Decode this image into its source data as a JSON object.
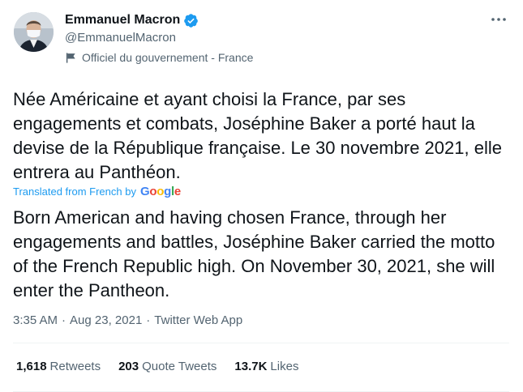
{
  "author": {
    "display_name": "Emmanuel Macron",
    "handle": "@EmmanuelMacron",
    "label": "Officiel du gouvernement - France"
  },
  "tweet": {
    "original_text": "Née Américaine et ayant choisi la France, par ses engagements et combats, Joséphine Baker a porté haut la devise de la République française. Le 30 novembre 2021, elle entrera au Panthéon.",
    "translated_from": "Translated from French by",
    "translator_brand": [
      "G",
      "o",
      "o",
      "g",
      "l",
      "e"
    ],
    "translated_text": "Born American and having chosen France, through her engagements and battles, Joséphine Baker carried the motto of the French Republic high. On November 30, 2021, she will enter the Pantheon."
  },
  "meta": {
    "time": "3:35 AM",
    "separator": "·",
    "date": "Aug 23, 2021",
    "source": "Twitter Web App"
  },
  "stats": {
    "retweets": {
      "count": "1,618",
      "label": "Retweets"
    },
    "quote_tweets": {
      "count": "203",
      "label": "Quote Tweets"
    },
    "likes": {
      "count": "13.7K",
      "label": "Likes"
    }
  },
  "colors": {
    "accent": "#1d9bf0",
    "text_primary": "#0f1419",
    "text_secondary": "#536471",
    "divider": "#eff3f4"
  },
  "icons": {
    "verified": "verified-badge-icon",
    "label_flag": "flag-icon",
    "more": "more-horizontal-icon"
  }
}
